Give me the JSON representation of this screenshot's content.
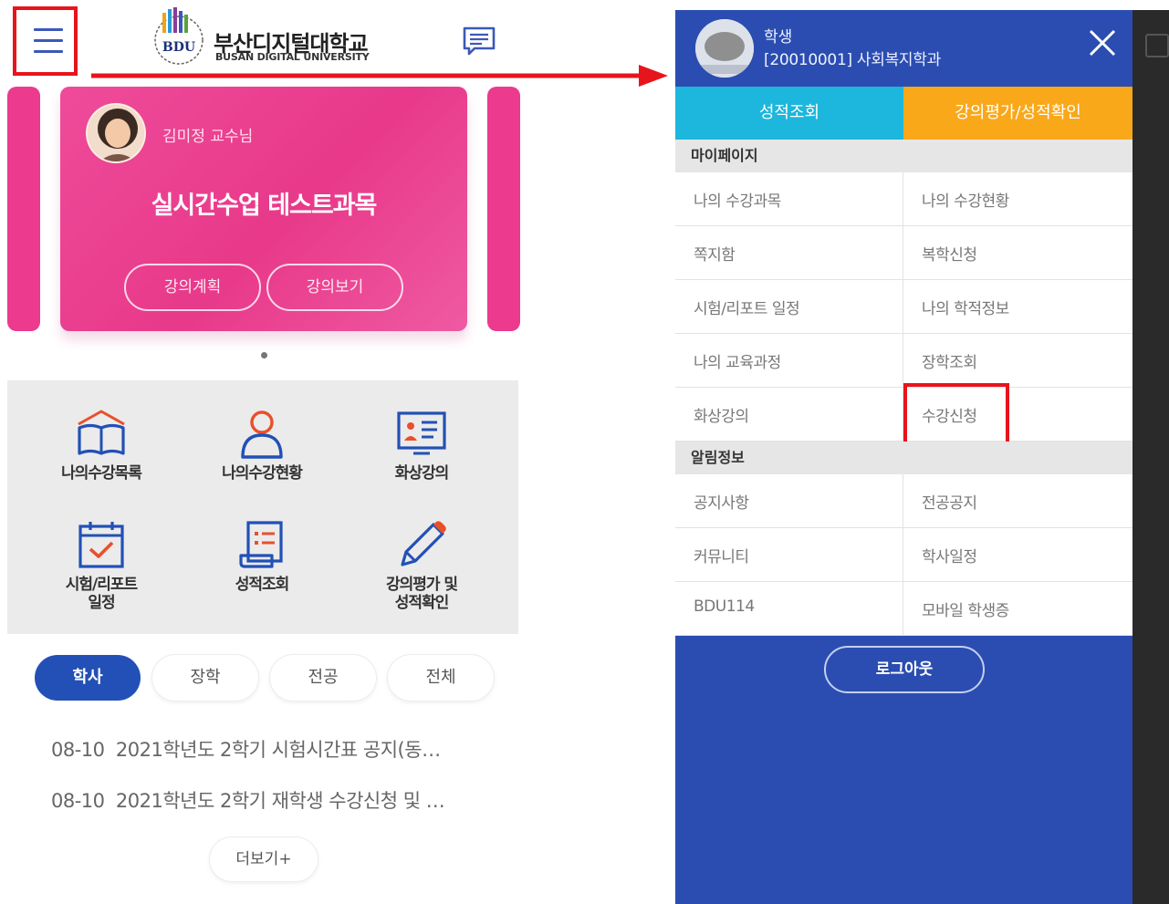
{
  "left_screen": {
    "header": {
      "logo_mark": "BDU",
      "logo_korean": "부산디지털대학교",
      "logo_english": "BUSAN DIGITAL UNIVERSITY",
      "menu_icon": "hamburger-menu-icon",
      "message_icon": "message-icon"
    },
    "course_card": {
      "professor": "김미정 교수님",
      "title": "실시간수업 테스트과목",
      "buttons": [
        "강의계획",
        "강의보기"
      ],
      "color": "#e8398a"
    },
    "quick_menu": [
      {
        "label": "나의수강목록",
        "icon": "open-book-icon"
      },
      {
        "label": "나의수강현황",
        "icon": "person-icon"
      },
      {
        "label": "화상강의",
        "icon": "video-lecture-icon"
      },
      {
        "label_line1": "시험/리포트",
        "label_line2": "일정",
        "icon": "calendar-check-icon"
      },
      {
        "label": "성적조회",
        "icon": "grade-list-icon"
      },
      {
        "label_line1": "강의평가 및",
        "label_line2": "성적확인",
        "icon": "pencil-icon"
      }
    ],
    "notice_tabs": [
      "학사",
      "장학",
      "전공",
      "전체"
    ],
    "active_tab": "학사",
    "notices": [
      {
        "date": "08-10",
        "title": "2021학년도 2학기 시험시간표 공지(동…"
      },
      {
        "date": "08-10",
        "title": "2021학년도 2학기 재학생 수강신청 및 …"
      }
    ],
    "more_button": "더보기+"
  },
  "right_screen": {
    "user": {
      "role": "학생",
      "info": "[20010001] 사회복지학과"
    },
    "close_icon": "close-icon",
    "quick_buttons": [
      {
        "label": "성적조회",
        "color": "#1db6dc"
      },
      {
        "label": "강의평가/성적확인",
        "color": "#f9a81a"
      }
    ],
    "sections": [
      {
        "title": "마이페이지",
        "items": [
          "나의 수강과목",
          "나의 수강현황",
          "쪽지함",
          "복학신청",
          "시험/리포트 일정",
          "나의 학적정보",
          "나의 교육과정",
          "장학조회",
          "화상강의",
          "수강신청"
        ]
      },
      {
        "title": "알림정보",
        "items": [
          "공지사항",
          "전공공지",
          "커뮤니티",
          "학사일정",
          "BDU114",
          "모바일 학생증"
        ]
      }
    ],
    "highlighted_item": "수강신청",
    "logout_button": "로그아웃",
    "drawer_color": "#2b4db1"
  },
  "annotation": {
    "highlight_color": "#e8141c"
  }
}
